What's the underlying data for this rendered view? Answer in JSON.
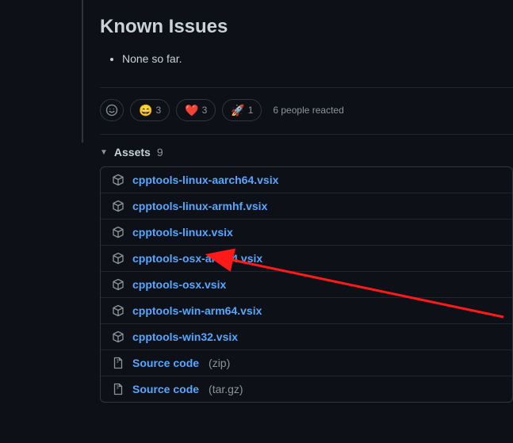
{
  "heading": "Known Issues",
  "issue_text": "None so far.",
  "reactions": [
    {
      "emoji": "😄",
      "count": 3
    },
    {
      "emoji": "❤️",
      "count": 3
    },
    {
      "emoji": "🚀",
      "count": 1
    }
  ],
  "reaction_summary": "6 people reacted",
  "assets_label": "Assets",
  "assets_count": 9,
  "assets": [
    {
      "type": "pkg",
      "name": "cpptools-linux-aarch64.vsix"
    },
    {
      "type": "pkg",
      "name": "cpptools-linux-armhf.vsix"
    },
    {
      "type": "pkg",
      "name": "cpptools-linux.vsix"
    },
    {
      "type": "pkg",
      "name": "cpptools-osx-arm64.vsix"
    },
    {
      "type": "pkg",
      "name": "cpptools-osx.vsix"
    },
    {
      "type": "pkg",
      "name": "cpptools-win-arm64.vsix"
    },
    {
      "type": "pkg",
      "name": "cpptools-win32.vsix"
    },
    {
      "type": "zip",
      "name": "Source code",
      "ext": "(zip)"
    },
    {
      "type": "zip",
      "name": "Source code",
      "ext": "(tar.gz)"
    }
  ]
}
